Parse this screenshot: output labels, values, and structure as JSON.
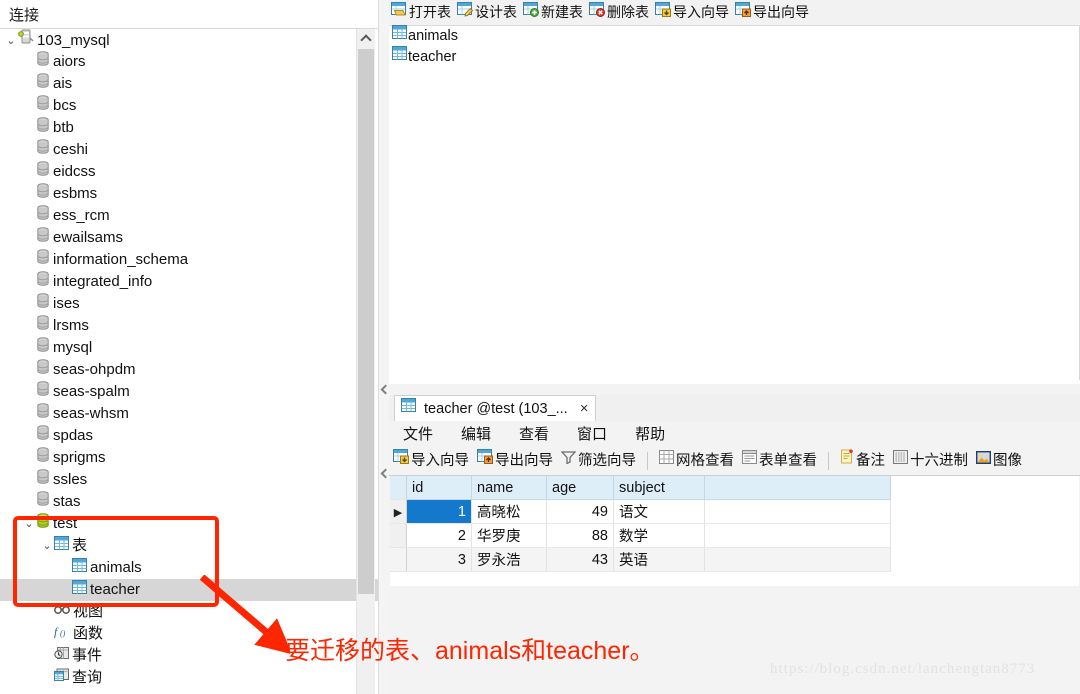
{
  "connections_panel": {
    "header": "连接",
    "tree": [
      {
        "label": "103_mysql",
        "icon": "connection-icon",
        "depth": 0,
        "twisty": "expanded"
      },
      {
        "label": "aiors",
        "icon": "database-icon",
        "depth": 1,
        "twisty": "none"
      },
      {
        "label": "ais",
        "icon": "database-icon",
        "depth": 1,
        "twisty": "none"
      },
      {
        "label": "bcs",
        "icon": "database-icon",
        "depth": 1,
        "twisty": "none"
      },
      {
        "label": "btb",
        "icon": "database-icon",
        "depth": 1,
        "twisty": "none"
      },
      {
        "label": "ceshi",
        "icon": "database-icon",
        "depth": 1,
        "twisty": "none"
      },
      {
        "label": "eidcss",
        "icon": "database-icon",
        "depth": 1,
        "twisty": "none"
      },
      {
        "label": "esbms",
        "icon": "database-icon",
        "depth": 1,
        "twisty": "none"
      },
      {
        "label": "ess_rcm",
        "icon": "database-icon",
        "depth": 1,
        "twisty": "none"
      },
      {
        "label": "ewailsams",
        "icon": "database-icon",
        "depth": 1,
        "twisty": "none"
      },
      {
        "label": "information_schema",
        "icon": "database-icon",
        "depth": 1,
        "twisty": "none"
      },
      {
        "label": "integrated_info",
        "icon": "database-icon",
        "depth": 1,
        "twisty": "none"
      },
      {
        "label": "ises",
        "icon": "database-icon",
        "depth": 1,
        "twisty": "none"
      },
      {
        "label": "lrsms",
        "icon": "database-icon",
        "depth": 1,
        "twisty": "none"
      },
      {
        "label": "mysql",
        "icon": "database-icon",
        "depth": 1,
        "twisty": "none"
      },
      {
        "label": "seas-ohpdm",
        "icon": "database-icon",
        "depth": 1,
        "twisty": "none"
      },
      {
        "label": "seas-spalm",
        "icon": "database-icon",
        "depth": 1,
        "twisty": "none"
      },
      {
        "label": "seas-whsm",
        "icon": "database-icon",
        "depth": 1,
        "twisty": "none"
      },
      {
        "label": "spdas",
        "icon": "database-icon",
        "depth": 1,
        "twisty": "none"
      },
      {
        "label": "sprigms",
        "icon": "database-icon",
        "depth": 1,
        "twisty": "none"
      },
      {
        "label": "ssles",
        "icon": "database-icon",
        "depth": 1,
        "twisty": "none"
      },
      {
        "label": "stas",
        "icon": "database-icon",
        "depth": 1,
        "twisty": "none"
      },
      {
        "label": "test",
        "icon": "database-open-icon",
        "depth": 1,
        "twisty": "expanded"
      },
      {
        "label": "表",
        "icon": "tables-folder-icon",
        "depth": 2,
        "twisty": "expanded"
      },
      {
        "label": "animals",
        "icon": "table-icon",
        "depth": 3,
        "twisty": "none"
      },
      {
        "label": "teacher",
        "icon": "table-icon",
        "depth": 3,
        "twisty": "none",
        "selected": true
      },
      {
        "label": "视图",
        "icon": "views-icon",
        "depth": 2,
        "twisty": "none"
      },
      {
        "label": "函数",
        "icon": "functions-icon",
        "depth": 2,
        "twisty": "none"
      },
      {
        "label": "事件",
        "icon": "events-icon",
        "depth": 2,
        "twisty": "none"
      },
      {
        "label": "查询",
        "icon": "queries-icon",
        "depth": 2,
        "twisty": "none"
      }
    ]
  },
  "main_toolbar": {
    "items": [
      {
        "label": "打开表",
        "icon": "open-table-icon"
      },
      {
        "label": "设计表",
        "icon": "design-table-icon"
      },
      {
        "label": "新建表",
        "icon": "new-table-icon"
      },
      {
        "label": "删除表",
        "icon": "delete-table-icon"
      },
      {
        "label": "导入向导",
        "icon": "import-wizard-icon"
      },
      {
        "label": "导出向导",
        "icon": "export-wizard-icon"
      }
    ]
  },
  "object_list": {
    "items": [
      {
        "label": "animals",
        "icon": "table-icon"
      },
      {
        "label": "teacher",
        "icon": "table-icon"
      }
    ]
  },
  "editor": {
    "tab": {
      "label": "teacher @test (103_...",
      "icon": "table-icon",
      "close": "×"
    },
    "menu": [
      "文件",
      "编辑",
      "查看",
      "窗口",
      "帮助"
    ],
    "toolbar": [
      {
        "label": "导入向导",
        "icon": "import-wizard-icon",
        "type": "button"
      },
      {
        "label": "导出向导",
        "icon": "export-wizard-icon",
        "type": "button"
      },
      {
        "label": "筛选向导",
        "icon": "filter-wizard-icon",
        "type": "button"
      },
      {
        "type": "separator"
      },
      {
        "label": "网格查看",
        "icon": "grid-view-icon",
        "type": "button"
      },
      {
        "label": "表单查看",
        "icon": "form-view-icon",
        "type": "button"
      },
      {
        "type": "separator"
      },
      {
        "label": "备注",
        "icon": "memo-icon",
        "type": "button"
      },
      {
        "label": "十六进制",
        "icon": "hex-icon",
        "type": "button"
      },
      {
        "label": "图像",
        "icon": "image-icon",
        "type": "button"
      }
    ],
    "grid": {
      "columns": [
        "id",
        "name",
        "age",
        "subject"
      ],
      "rows": [
        {
          "id": "1",
          "name": "高晓松",
          "age": "49",
          "subject": "语文",
          "current": true
        },
        {
          "id": "2",
          "name": "华罗庚",
          "age": "88",
          "subject": "数学",
          "current": false
        },
        {
          "id": "3",
          "name": "罗永浩",
          "age": "43",
          "subject": "英语",
          "current": false
        }
      ]
    }
  },
  "annotation": {
    "text": "要迁移的表、animals和teacher。",
    "color": "#fe2600"
  },
  "watermark": {
    "text": "https://blog.csdn.net/lanchengtan8773"
  }
}
